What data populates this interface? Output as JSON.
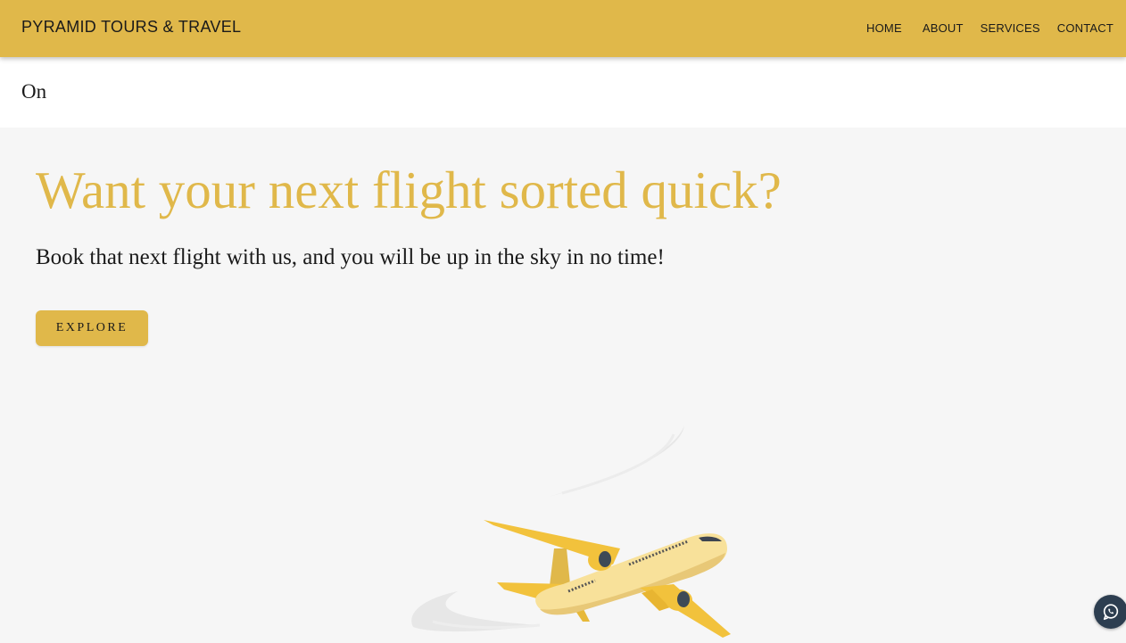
{
  "header": {
    "brand": "PYRAMID TOURS & TRAVEL",
    "nav": [
      "HOME",
      "ABOUT",
      "SERVICES",
      "CONTACT"
    ]
  },
  "subbar": {
    "text": "On"
  },
  "hero": {
    "title": "Want your next flight sorted quick?",
    "subtitle": "Book that next flight with us, and you will be up in the sky in no time!",
    "button_label": "EXPLORE"
  },
  "icons": {
    "plane": "airplane-illustration",
    "whatsapp": "whatsapp-icon"
  },
  "colors": {
    "accent": "#e0b84a",
    "background": "#f6f6f6",
    "chat_button": "#2d3e50"
  }
}
